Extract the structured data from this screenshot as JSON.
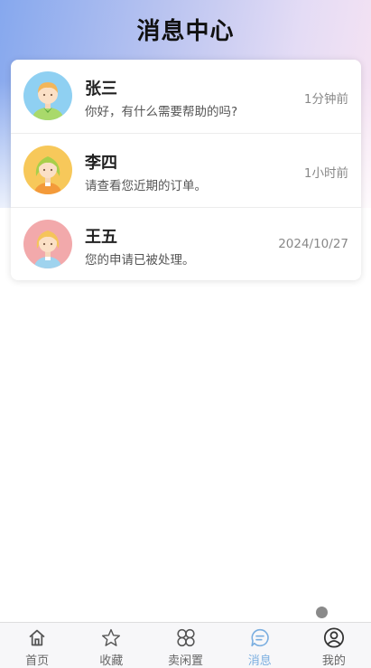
{
  "page": {
    "title": "消息中心"
  },
  "messages": [
    {
      "name": "张三",
      "text": "你好，有什么需要帮助的吗?",
      "time": "1分钟前",
      "avatar": "boy-avatar"
    },
    {
      "name": "李四",
      "text": "请查看您近期的订单。",
      "time": "1小时前",
      "avatar": "girl-avatar"
    },
    {
      "name": "王五",
      "text": "您的申请已被处理。",
      "time": "2024/10/27",
      "avatar": "girl-avatar"
    }
  ],
  "tabbar": {
    "active": "消息",
    "items": [
      {
        "label": "首页",
        "icon": "home-icon"
      },
      {
        "label": "收藏",
        "icon": "star-icon"
      },
      {
        "label": "卖闲置",
        "icon": "grid-icon"
      },
      {
        "label": "消息",
        "icon": "chat-icon"
      },
      {
        "label": "我的",
        "icon": "user-icon"
      }
    ]
  },
  "colors": {
    "accent": "#7aaee0",
    "header_start": "#86a8ee",
    "header_end": "#f8e4f2"
  }
}
